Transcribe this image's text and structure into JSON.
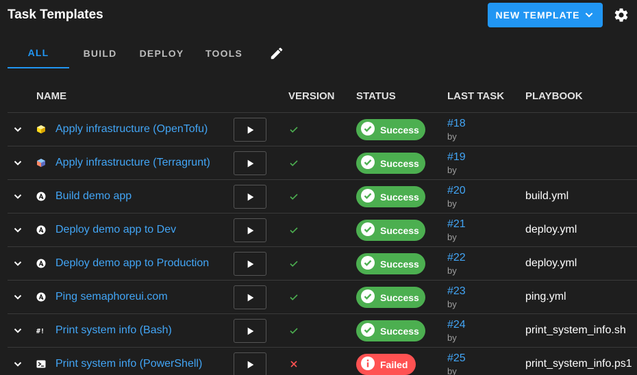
{
  "header": {
    "title": "Task Templates",
    "new_template_label": "NEW TEMPLATE"
  },
  "tabs": [
    {
      "label": "ALL",
      "active": true
    },
    {
      "label": "BUILD",
      "active": false
    },
    {
      "label": "DEPLOY",
      "active": false
    },
    {
      "label": "TOOLS",
      "active": false
    }
  ],
  "table": {
    "columns": [
      "NAME",
      "VERSION",
      "STATUS",
      "LAST TASK",
      "PLAYBOOK"
    ],
    "rows": [
      {
        "name": "Apply infrastructure (OpenTofu)",
        "icon": "opentofu-icon",
        "status": "Success",
        "task": "#18",
        "by": "by",
        "playbook": ""
      },
      {
        "name": "Apply infrastructure (Terragrunt)",
        "icon": "terragrunt-icon",
        "status": "Success",
        "task": "#19",
        "by": "by",
        "playbook": ""
      },
      {
        "name": "Build demo app",
        "icon": "ansible-icon",
        "status": "Success",
        "task": "#20",
        "by": "by",
        "playbook": "build.yml"
      },
      {
        "name": "Deploy demo app to Dev",
        "icon": "ansible-icon",
        "status": "Success",
        "task": "#21",
        "by": "by",
        "playbook": "deploy.yml"
      },
      {
        "name": "Deploy demo app to Production",
        "icon": "ansible-icon",
        "status": "Success",
        "task": "#22",
        "by": "by",
        "playbook": "deploy.yml"
      },
      {
        "name": "Ping semaphoreui.com",
        "icon": "ansible-icon",
        "status": "Success",
        "task": "#23",
        "by": "by",
        "playbook": "ping.yml"
      },
      {
        "name": "Print system info (Bash)",
        "icon": "bash-icon",
        "status": "Success",
        "task": "#24",
        "by": "by",
        "playbook": "print_system_info.sh"
      },
      {
        "name": "Print system info (PowerShell)",
        "icon": "powershell-icon",
        "status": "Failed",
        "task": "#25",
        "by": "by",
        "playbook": "print_system_info.ps1"
      }
    ]
  },
  "colors": {
    "accent": "#2196f3",
    "success": "#4caf50",
    "failed": "#ff5252",
    "background": "#1e1e1e"
  }
}
